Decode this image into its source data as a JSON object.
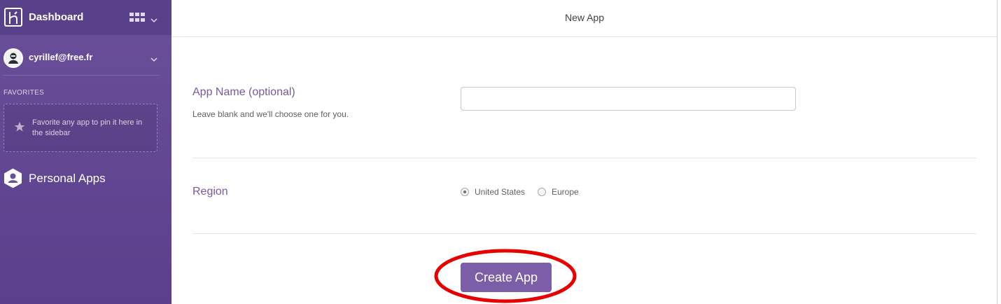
{
  "sidebar": {
    "title": "Dashboard",
    "user_email": "cyrillef@free.fr",
    "favorites_heading": "FAVORITES",
    "favorites_placeholder": "Favorite any app to pin it here in the sidebar",
    "personal_apps_label": "Personal Apps"
  },
  "header": {
    "title": "New App"
  },
  "form": {
    "app_name": {
      "label": "App Name (optional)",
      "help": "Leave blank and we'll choose one for you.",
      "value": ""
    },
    "region": {
      "label": "Region",
      "options": [
        {
          "label": "United States",
          "selected": true
        },
        {
          "label": "Europe",
          "selected": false
        }
      ]
    },
    "submit_label": "Create App"
  },
  "icons": {
    "logo": "heroku-logo-icon",
    "apps_grid": "grid-icon",
    "chevron": "chevron-down-icon",
    "favorite": "star-icon",
    "personal_apps": "user-hexagon-icon"
  },
  "colors": {
    "sidebar_bg": "#6a4f9a",
    "accent": "#79589f",
    "button_bg": "#7c5ea8",
    "annotation": "#e60000"
  }
}
